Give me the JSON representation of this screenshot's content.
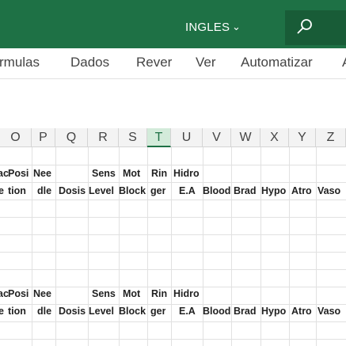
{
  "titlebar": {
    "language": "INGLES",
    "chevron_icon": "chevron-down-icon",
    "search_icon": "search-icon",
    "color": "#1e7145"
  },
  "menu": [
    "rmulas",
    "Dados",
    "Rever",
    "Ver",
    "Automatizar",
    "A"
  ],
  "columns": [
    "O",
    "P",
    "Q",
    "R",
    "S",
    "T",
    "U",
    "V",
    "W",
    "X",
    "Y",
    "Z"
  ],
  "selected_column": "T",
  "header_rows": [
    {
      "line1": [
        "ac",
        "Posi",
        "Nee",
        "",
        "Sens",
        "Mot",
        "Rin",
        "Hidro",
        "",
        "",
        "",
        "",
        ""
      ],
      "line2": [
        "e",
        "tion",
        "dle",
        "Dosis",
        "Level",
        "Block",
        "ger",
        "E.A",
        "Blood",
        "Brad",
        "Hypo",
        "Atro",
        "Vaso"
      ]
    },
    {
      "line1": [
        "ac",
        "Posi",
        "Nee",
        "",
        "Sens",
        "Mot",
        "Rin",
        "Hidro",
        "",
        "",
        "",
        "",
        ""
      ],
      "line2": [
        "e",
        "tion",
        "dle",
        "Dosis",
        "Level",
        "Block",
        "ger",
        "E.A",
        "Blood",
        "Brad",
        "Hypo",
        "Atro",
        "Vaso"
      ]
    }
  ]
}
